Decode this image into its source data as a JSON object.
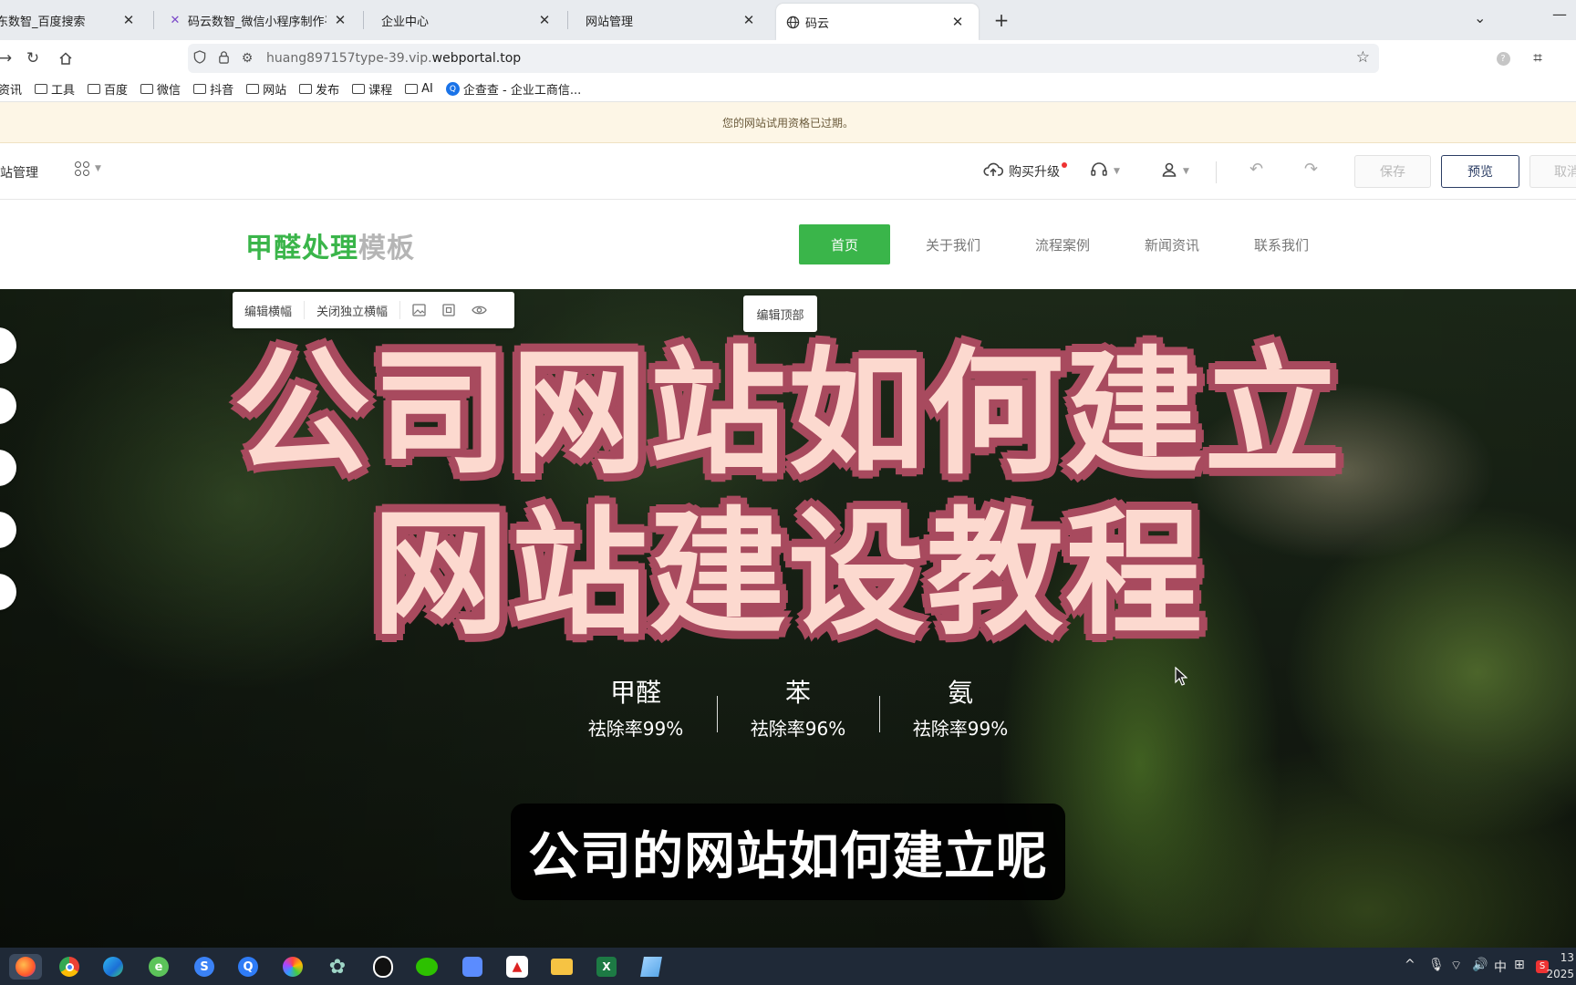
{
  "browser": {
    "tabs": [
      {
        "title": "东数智_百度搜索",
        "favicon": "none",
        "active": false
      },
      {
        "title": "码云数智_微信小程序制作平台_",
        "favicon": "mayun-logo-icon",
        "active": false
      },
      {
        "title": "企业中心",
        "favicon": "none",
        "active": false
      },
      {
        "title": "网站管理",
        "favicon": "none",
        "active": false
      },
      {
        "title": "码云",
        "favicon": "globe-icon",
        "active": true
      }
    ],
    "address": {
      "prefix": "huang897157type-39.vip.",
      "domain": "webportal.top"
    },
    "bookmarks": [
      "资讯",
      "工具",
      "百度",
      "微信",
      "抖音",
      "网站",
      "发布",
      "课程",
      "AI",
      "企查查 - 企业工商信..."
    ]
  },
  "notice": "您的网站试用资格已过期。",
  "editor": {
    "title": "网站管理",
    "upgrade_label": "购买升级",
    "save_label": "保存",
    "preview_label": "预览",
    "cancel_label": "取消"
  },
  "site": {
    "logo_main": "甲醛处理",
    "logo_sub": "模板",
    "nav": [
      "首页",
      "关于我们",
      "流程案例",
      "新闻资讯",
      "联系我们"
    ],
    "accent_color": "#3ab54a"
  },
  "banner_tools": {
    "edit_banner": "编辑横幅",
    "close_banner": "关闭独立横幅",
    "edit_top": "编辑顶部"
  },
  "hero": {
    "title_line1": "公司网站如何建立",
    "title_line2": "网站建设教程",
    "stats": [
      {
        "name": "甲醛",
        "value": "祛除率99%"
      },
      {
        "name": "苯",
        "value": "祛除率96%"
      },
      {
        "name": "氨",
        "value": "祛除率99%"
      }
    ],
    "caption": "公司的网站如何建立呢"
  },
  "taskbar": {
    "ime": "中",
    "time": "13",
    "date": "2025"
  }
}
